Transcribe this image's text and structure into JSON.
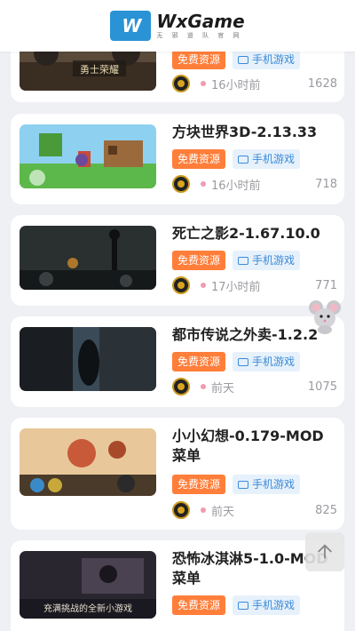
{
  "header": {
    "brand": "WxGame",
    "subtitle": "无 邪 道 队 官 网",
    "logo_mark": "W"
  },
  "tags": {
    "free": "免费资源",
    "category": "手机游戏"
  },
  "items": [
    {
      "title": "",
      "time": "16小时前",
      "views": "1628"
    },
    {
      "title": "方块世界3D-2.13.33",
      "time": "16小时前",
      "views": "718"
    },
    {
      "title": "死亡之影2-1.67.10.0",
      "time": "17小时前",
      "views": "771"
    },
    {
      "title": "都市传说之外卖-1.2.2",
      "time": "前天",
      "views": "1075"
    },
    {
      "title": "小小幻想-0.179-MOD菜单",
      "time": "前天",
      "views": "825"
    },
    {
      "title": "恐怖冰淇淋5-1.0-MOD菜单",
      "time": "",
      "views": ""
    }
  ],
  "thumb_texts": {
    "item0": "勇士荣耀",
    "item5": "充满挑战的全新小游戏"
  },
  "icons": {
    "logo": "wxgame-logo-icon",
    "folder": "folder-icon",
    "avatar": "author-avatar-icon",
    "mascot": "mouse-mascot-icon",
    "back_to_top": "back-to-top-icon"
  },
  "colors": {
    "free_tag": "#ff7e3a",
    "category_tag_bg": "#e6f1fb",
    "category_tag_text": "#3b8ad8",
    "time_dot": "#f29ab0"
  }
}
